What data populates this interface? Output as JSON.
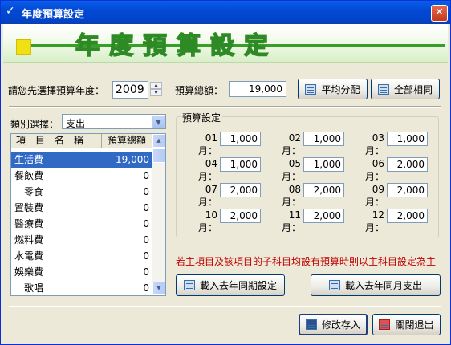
{
  "window": {
    "title": "年度預算設定",
    "close_glyph": "✕",
    "title_icon_glyph": "✓"
  },
  "banner": {
    "title": "年度預算設定"
  },
  "top": {
    "year_label": "請您先選擇預算年度：",
    "year_value": "2009",
    "total_label": "預算總額：",
    "total_value": "19,000",
    "avg_button": "平均分配",
    "same_button": "全部相同"
  },
  "category": {
    "label": "類別選擇：",
    "value": "支出"
  },
  "list": {
    "headers": [
      "項　目　名　稱",
      "預算總額"
    ],
    "rows": [
      {
        "name": "生活費",
        "amount": "19,000",
        "selected": true
      },
      {
        "name": "餐飲費",
        "amount": "0"
      },
      {
        "name": "　零食",
        "amount": "0"
      },
      {
        "name": "置裝費",
        "amount": "0"
      },
      {
        "name": "醫療費",
        "amount": "0"
      },
      {
        "name": "燃料費",
        "amount": "0"
      },
      {
        "name": "水電費",
        "amount": "0"
      },
      {
        "name": "娛樂費",
        "amount": "0"
      },
      {
        "name": "　歌唱",
        "amount": "0"
      }
    ]
  },
  "budget": {
    "title": "預算設定",
    "months": [
      {
        "label": "01 月：",
        "value": "1,000"
      },
      {
        "label": "02 月：",
        "value": "1,000"
      },
      {
        "label": "03 月：",
        "value": "1,000"
      },
      {
        "label": "04 月：",
        "value": "1,000"
      },
      {
        "label": "05 月：",
        "value": "1,000"
      },
      {
        "label": "06 月：",
        "value": "2,000"
      },
      {
        "label": "07 月：",
        "value": "2,000"
      },
      {
        "label": "08 月：",
        "value": "2,000"
      },
      {
        "label": "09 月：",
        "value": "2,000"
      },
      {
        "label": "10 月：",
        "value": "2,000"
      },
      {
        "label": "11 月：",
        "value": "2,000"
      },
      {
        "label": "12 月：",
        "value": "2,000"
      }
    ]
  },
  "note": "若主項目及該項目的子科目均設有預算時則以主科目設定為主",
  "buttons": {
    "load_last_year_setting": "載入去年同期設定",
    "load_last_year_expense": "載入去年同月支出",
    "save": "修改存入",
    "close": "關閉退出"
  }
}
